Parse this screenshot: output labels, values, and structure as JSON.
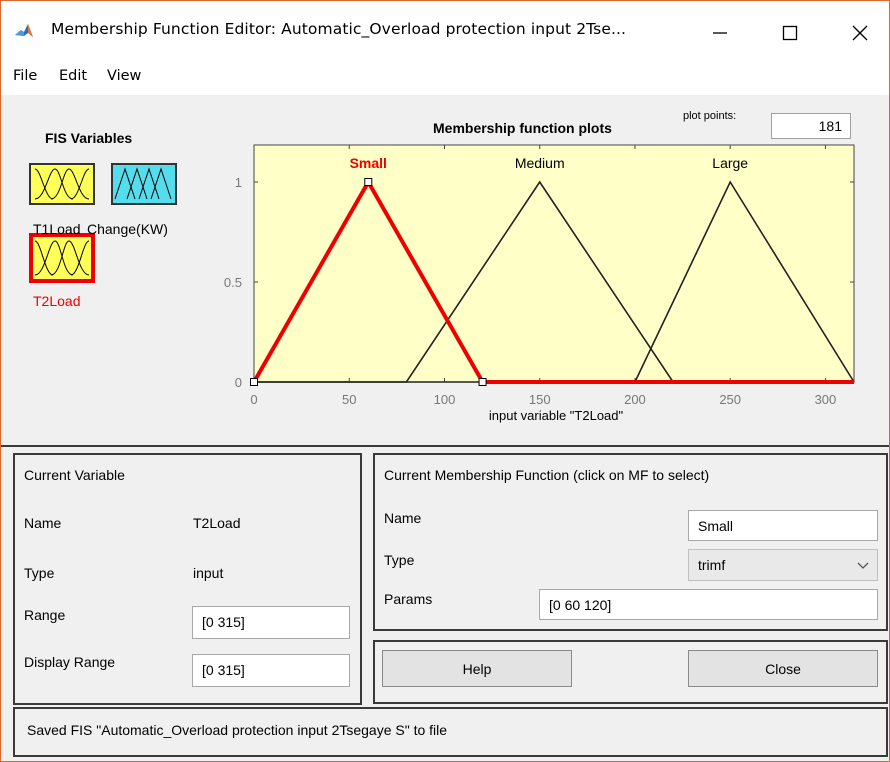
{
  "window": {
    "title": "Membership Function Editor: Automatic_Overload protection input 2Tse..."
  },
  "menu": [
    "File",
    "Edit",
    "View"
  ],
  "fis_variables": {
    "heading": "FIS Variables",
    "items": [
      {
        "label": "T1Load",
        "kind": "input",
        "selected": false
      },
      {
        "label": "Change(KW)",
        "kind": "output",
        "selected": false
      },
      {
        "label": "T2Load",
        "kind": "input",
        "selected": true
      }
    ]
  },
  "plot": {
    "title": "Membership function plots",
    "plot_points_label": "plot points:",
    "plot_points_value": "181",
    "xlabel": "input variable \"T2Load\"",
    "x_ticks": [
      "0",
      "50",
      "100",
      "150",
      "200",
      "250",
      "300"
    ],
    "y_ticks": [
      "0",
      "0.5",
      "1"
    ]
  },
  "chart_data": {
    "type": "line",
    "xlabel": "input variable \"T2Load\"",
    "ylabel": "",
    "xlim": [
      0,
      315
    ],
    "ylim": [
      0,
      1
    ],
    "series": [
      {
        "name": "Small",
        "params": [
          0,
          60,
          120
        ],
        "selected": true
      },
      {
        "name": "Medium",
        "params": [
          80,
          150,
          220
        ],
        "selected": false
      },
      {
        "name": "Large",
        "params": [
          200,
          250,
          315
        ],
        "selected": false
      }
    ]
  },
  "current_variable": {
    "heading": "Current Variable",
    "name_label": "Name",
    "name_value": "T2Load",
    "type_label": "Type",
    "type_value": "input",
    "range_label": "Range",
    "range_value": "[0 315]",
    "display_range_label": "Display Range",
    "display_range_value": "[0 315]"
  },
  "current_mf": {
    "heading": "Current Membership Function (click on MF to select)",
    "name_label": "Name",
    "name_value": "Small",
    "type_label": "Type",
    "type_value": "trimf",
    "params_label": "Params",
    "params_value": "[0 60 120]"
  },
  "buttons": {
    "help": "Help",
    "close": "Close"
  },
  "status": "Saved FIS \"Automatic_Overload protection input 2Tsegaye S\" to file",
  "colors": {
    "plot_bg": "#ffffc8",
    "selected": "#ee0000",
    "input_var": "#ffff5a",
    "output_var": "#55ddee"
  },
  "icons": [
    "matlab-icon",
    "minimize-icon",
    "maximize-icon",
    "close-icon",
    "chevron-down-icon"
  ]
}
